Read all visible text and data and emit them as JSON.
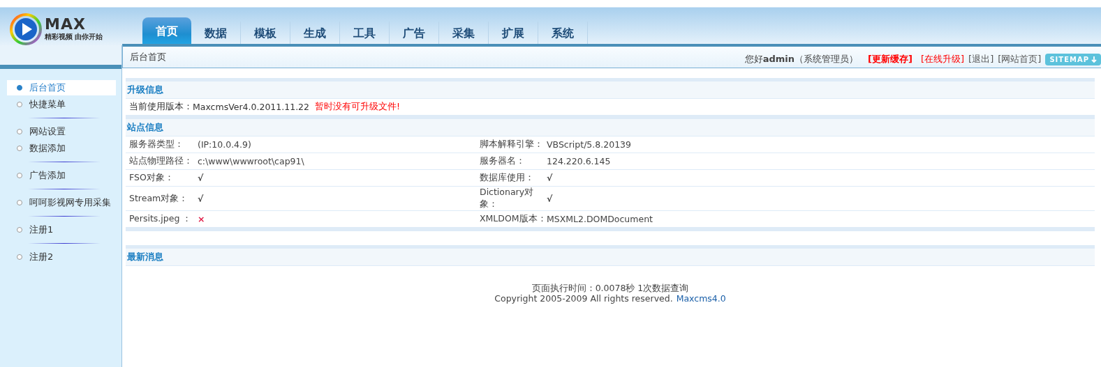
{
  "logo": {
    "wordmark": "MAX",
    "tagline": "精彩视频 由你开始"
  },
  "tabs": [
    {
      "label": "首页",
      "selected": true
    },
    {
      "label": "数据",
      "selected": false
    },
    {
      "label": "模板",
      "selected": false
    },
    {
      "label": "生成",
      "selected": false
    },
    {
      "label": "工具",
      "selected": false
    },
    {
      "label": "广告",
      "selected": false
    },
    {
      "label": "采集",
      "selected": false
    },
    {
      "label": "扩展",
      "selected": false
    },
    {
      "label": "系统",
      "selected": false
    }
  ],
  "breadcrumb": "后台首页",
  "user_bar": {
    "greeting": "您好**admin**（系统管理员）",
    "links": [
      {
        "label": "[更新缓存]",
        "kind": "strong"
      },
      {
        "label": "[在线升级]",
        "kind": "alert"
      },
      {
        "label": "[退出]",
        "kind": "plain"
      },
      {
        "label": "[网站首页]",
        "kind": "plain"
      }
    ],
    "sitemap": "SITEMAP"
  },
  "sidebar": {
    "groups": [
      [
        {
          "label": "后台首页",
          "selected": true
        },
        {
          "label": "快捷菜单",
          "selected": false
        }
      ],
      [
        {
          "label": "网站设置",
          "selected": false
        },
        {
          "label": "数据添加",
          "selected": false
        }
      ],
      [
        {
          "label": "广告添加",
          "selected": false
        }
      ],
      [
        {
          "label": "呵呵影视网专用采集",
          "selected": false
        }
      ],
      [
        {
          "label": "注册1",
          "selected": false
        }
      ],
      [
        {
          "label": "注册2",
          "selected": false
        }
      ]
    ]
  },
  "upgrade": {
    "title": "升级信息",
    "label": "当前使用版本：",
    "version": "MaxcmsVer4.0.2011.11.22",
    "notice": "暂时没有可升级文件!"
  },
  "site_info": {
    "title": "站点信息",
    "rows": [
      [
        {
          "label": "服务器类型：",
          "value": "(IP:10.0.4.9)",
          "kind": "text"
        },
        {
          "label": "脚本解释引擎：",
          "value": "VBScript/5.8.20139",
          "kind": "text"
        }
      ],
      [
        {
          "label": "站点物理路径：",
          "value": "c:\\www\\wwwroot\\cap91\\",
          "kind": "text"
        },
        {
          "label": "服务器名：",
          "value": "124.220.6.145",
          "kind": "text"
        }
      ],
      [
        {
          "label": "FSO对象：",
          "value": "√",
          "kind": "ok"
        },
        {
          "label": "数据库使用：",
          "value": "√",
          "kind": "ok"
        }
      ],
      [
        {
          "label": "Stream对象：",
          "value": "√",
          "kind": "ok"
        },
        {
          "label": "Dictionary对象：",
          "value": "√",
          "kind": "ok"
        }
      ],
      [
        {
          "label": "Persits.jpeg ：",
          "value": "×",
          "kind": "fail"
        },
        {
          "label": "XMLDOM版本：",
          "value": "MSXML2.DOMDocument",
          "kind": "text"
        }
      ]
    ]
  },
  "news": {
    "title": "最新消息"
  },
  "footer": {
    "timing": "页面执行时间：0.0078秒 1次数据查询",
    "copyright": "Copyright 2005-2009 All rights reserved.",
    "link": "Maxcms4.0"
  }
}
